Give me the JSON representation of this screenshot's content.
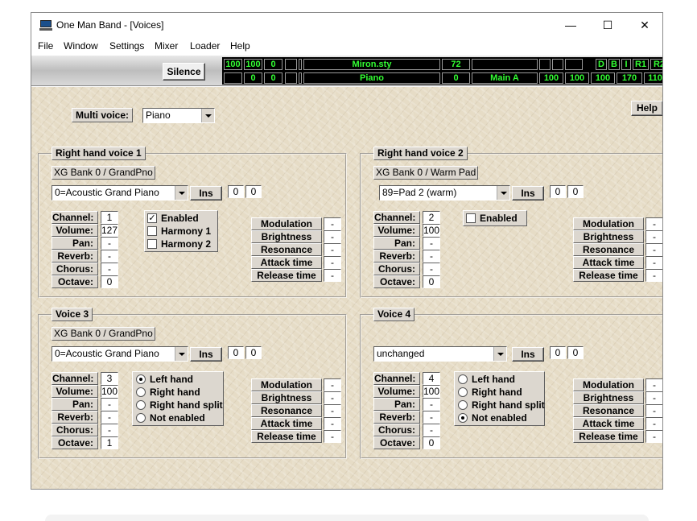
{
  "window": {
    "title": "One Man Band - [Voices]",
    "minimize": "—",
    "maximize": "☐",
    "close": "✕"
  },
  "menu": [
    "File",
    "Window",
    "Settings",
    "Mixer",
    "Loader",
    "Help"
  ],
  "toolbar": {
    "silence_label": "Silence",
    "lcd": {
      "r1": [
        "100",
        "100",
        "0",
        "",
        "",
        "Miron.sty",
        "72",
        "",
        "",
        "",
        "",
        "D",
        "B",
        "I",
        "R1",
        "R2"
      ],
      "r2": [
        "",
        "0",
        "0",
        "",
        "",
        "Piano",
        "0",
        "Main A",
        "100",
        "100",
        "100",
        "170",
        "110"
      ]
    }
  },
  "multi_voice": {
    "label": "Multi voice:",
    "value": "Piano"
  },
  "help_label": "Help",
  "param_labels": [
    "Channel:",
    "Volume:",
    "Pan:",
    "Reverb:",
    "Chorus:",
    "Octave:"
  ],
  "ctrl_labels": [
    "Modulation",
    "Brightness",
    "Resonance",
    "Attack time",
    "Release time"
  ],
  "ins_label": "Ins",
  "voices": [
    {
      "title": "Right hand voice 1",
      "bank": "XG Bank 0 / GrandPno",
      "instrument": "0=Acoustic Grand Piano",
      "ins_values": [
        "0",
        "0"
      ],
      "params": [
        "1",
        "127",
        "-",
        "-",
        "-",
        "0"
      ],
      "ctrl_values": [
        "-",
        "-",
        "-",
        "-",
        "-"
      ],
      "checks": [
        {
          "label": "Enabled",
          "checked": true
        },
        {
          "label": "Harmony 1",
          "checked": false
        },
        {
          "label": "Harmony 2",
          "checked": false
        }
      ]
    },
    {
      "title": "Right hand voice 2",
      "bank": "XG Bank 0 / Warm Pad",
      "instrument": "89=Pad 2 (warm)",
      "ins_values": [
        "0",
        "0"
      ],
      "params": [
        "2",
        "100",
        "-",
        "-",
        "-",
        "0"
      ],
      "ctrl_values": [
        "-",
        "-",
        "-",
        "-",
        "-"
      ],
      "checks": [
        {
          "label": "Enabled",
          "checked": false
        }
      ]
    },
    {
      "title": "Voice 3",
      "bank": "XG Bank 0 / GrandPno",
      "instrument": "0=Acoustic Grand Piano",
      "ins_values": [
        "0",
        "0"
      ],
      "params": [
        "3",
        "100",
        "-",
        "-",
        "-",
        "1"
      ],
      "ctrl_values": [
        "-",
        "-",
        "-",
        "-",
        "-"
      ],
      "radios": [
        {
          "label": "Left hand",
          "selected": true
        },
        {
          "label": "Right hand",
          "selected": false
        },
        {
          "label": "Right hand split",
          "selected": false
        },
        {
          "label": "Not enabled",
          "selected": false
        }
      ]
    },
    {
      "title": "Voice 4",
      "bank": "",
      "instrument": "unchanged",
      "ins_values": [
        "0",
        "0"
      ],
      "params": [
        "4",
        "100",
        "-",
        "-",
        "-",
        "0"
      ],
      "ctrl_values": [
        "-",
        "-",
        "-",
        "-",
        "-"
      ],
      "radios": [
        {
          "label": "Left hand",
          "selected": false
        },
        {
          "label": "Right hand",
          "selected": false
        },
        {
          "label": "Right hand split",
          "selected": false
        },
        {
          "label": "Not enabled",
          "selected": true
        }
      ]
    }
  ]
}
